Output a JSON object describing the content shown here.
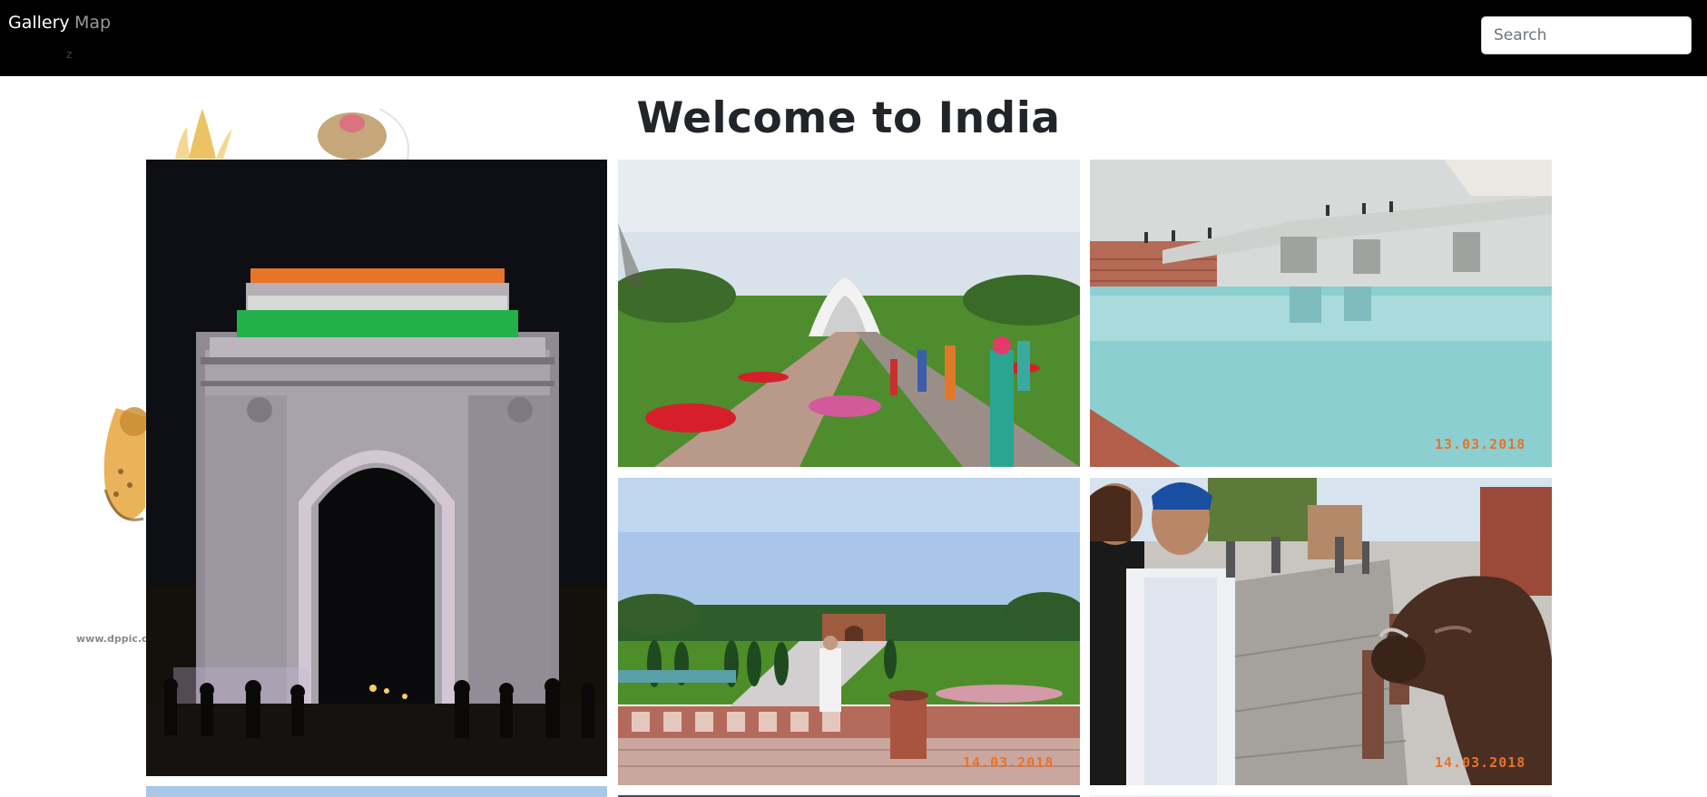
{
  "nav": {
    "items": [
      {
        "label": "Gallery"
      },
      {
        "label": "Map"
      }
    ],
    "hint": "z",
    "search_placeholder": "Search"
  },
  "page": {
    "title": "Welcome to India"
  },
  "background": {
    "watermark": "www.dppic.co"
  },
  "gallery": {
    "tiles": [
      {
        "subject": "India Gate at night",
        "date": ""
      },
      {
        "subject": "Lotus Temple gardens",
        "date": ""
      },
      {
        "subject": "Lotus Temple reflecting pool",
        "date": "13.03.2018"
      },
      {
        "subject": "Taj Mahal garden gate",
        "date": "14.03.2018"
      },
      {
        "subject": "Street with cow",
        "date": "14.03.2018"
      }
    ]
  },
  "colors": {
    "navbar_bg": "#000000",
    "nav_active": "#ffffff",
    "nav_inactive": "#9a9a9a",
    "date_stamp": "#e8722a"
  }
}
